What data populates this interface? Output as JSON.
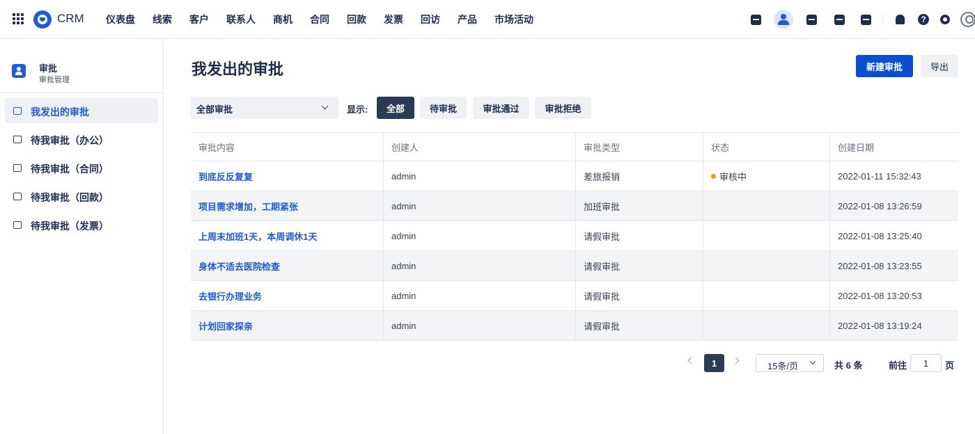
{
  "app": {
    "brand": "CRM"
  },
  "nav": {
    "items": [
      "仪表盘",
      "线索",
      "客户",
      "联系人",
      "商机",
      "合同",
      "回款",
      "发票",
      "回访",
      "产品",
      "市场活动"
    ]
  },
  "toolbar_icons": [
    "calendar-check-icon",
    "user-icon",
    "document-icon",
    "phone-icon",
    "calendar-icon",
    "bell-icon",
    "help-icon",
    "settings-icon",
    "avatar-icon"
  ],
  "sidebar": {
    "title": "审批",
    "subtitle": "审批管理",
    "items": [
      {
        "label": "我发出的审批",
        "icon": "stamp-icon",
        "active": true
      },
      {
        "label": "待我审批（办公）",
        "icon": "briefcase-icon",
        "active": false
      },
      {
        "label": "待我审批（合同）",
        "icon": "contract-icon",
        "active": false
      },
      {
        "label": "待我审批（回款）",
        "icon": "payment-icon",
        "active": false
      },
      {
        "label": "待我审批（发票）",
        "icon": "invoice-icon",
        "active": false
      }
    ]
  },
  "main": {
    "title": "我发出的审批",
    "new_button": "新建审批",
    "export_button": "导出",
    "filter_select": "全部审批",
    "show_label": "显示:",
    "filters": [
      "全部",
      "待审批",
      "审批通过",
      "审批拒绝"
    ],
    "active_filter": "全部"
  },
  "table": {
    "columns": [
      "审批内容",
      "创建人",
      "审批类型",
      "状态",
      "创建日期"
    ],
    "rows": [
      {
        "content": "到底反反复复",
        "creator": "admin",
        "type": "差旅报销",
        "status": "审核中",
        "date": "2022-01-11 15:32:43"
      },
      {
        "content": "项目需求增加，工期紧张",
        "creator": "admin",
        "type": "加班审批",
        "status": "",
        "date": "2022-01-08 13:26:59"
      },
      {
        "content": "上周末加班1天，本周调休1天",
        "creator": "admin",
        "type": "请假审批",
        "status": "",
        "date": "2022-01-08 13:25:40"
      },
      {
        "content": "身体不适去医院检查",
        "creator": "admin",
        "type": "请假审批",
        "status": "",
        "date": "2022-01-08 13:23:55"
      },
      {
        "content": "去银行办理业务",
        "creator": "admin",
        "type": "请假审批",
        "status": "",
        "date": "2022-01-08 13:20:53"
      },
      {
        "content": "计划回家探亲",
        "creator": "admin",
        "type": "请假审批",
        "status": "",
        "date": "2022-01-08 13:19:24"
      }
    ]
  },
  "pagination": {
    "current_page": "1",
    "page_size": "15条/页",
    "total": "共 6 条",
    "goto_label": "前往",
    "goto_value": "1",
    "page_unit": "页"
  },
  "colors": {
    "primary": "#0b4fd1",
    "active_filter": "#2b3a55",
    "status_pending": "#f59e0b",
    "link": "#1e5bd6"
  }
}
